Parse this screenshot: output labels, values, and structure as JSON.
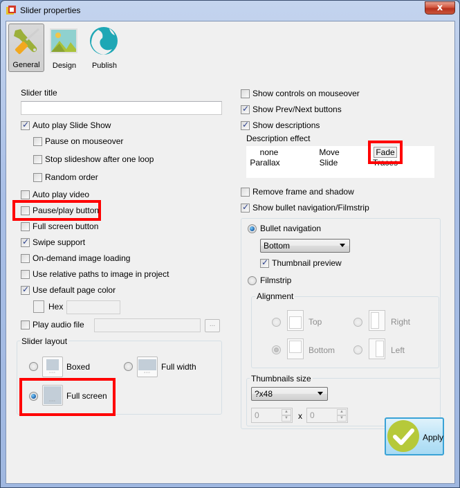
{
  "window": {
    "title": "Slider properties",
    "close_label": "x"
  },
  "tabs": [
    {
      "label": "General",
      "icon": "wrench-screwdriver-icon",
      "active": true
    },
    {
      "label": "Design",
      "icon": "picture-icon",
      "active": false
    },
    {
      "label": "Publish",
      "icon": "globe-icon",
      "active": false
    }
  ],
  "left": {
    "slider_title_label": "Slider title",
    "slider_title_value": "",
    "auto_play_slideshow": {
      "label": "Auto play Slide Show",
      "checked": true
    },
    "pause_on_mouseover": {
      "label": "Pause on mouseover",
      "checked": false
    },
    "stop_after_loop": {
      "label": "Stop slideshow after one loop",
      "checked": false
    },
    "random_order": {
      "label": "Random order",
      "checked": false
    },
    "auto_play_video": {
      "label": "Auto play video",
      "checked": false
    },
    "pause_play_button": {
      "label": "Pause/play button",
      "checked": false
    },
    "full_screen_button": {
      "label": "Full screen button",
      "checked": false
    },
    "swipe_support": {
      "label": "Swipe support",
      "checked": true
    },
    "on_demand_loading": {
      "label": "On-demand image loading",
      "checked": false
    },
    "relative_paths": {
      "label": "Use relative paths to image in project",
      "checked": false
    },
    "default_page_color": {
      "label": "Use default page color",
      "checked": true
    },
    "hex_label": "Hex",
    "hex_value": "",
    "play_audio": {
      "label": "Play audio file",
      "checked": false
    },
    "audio_file_value": "",
    "browse_label": "...",
    "slider_layout": {
      "title": "Slider layout",
      "options": [
        {
          "label": "Boxed",
          "selected": false
        },
        {
          "label": "Full width",
          "selected": false
        },
        {
          "label": "Full screen",
          "selected": true
        }
      ]
    }
  },
  "right": {
    "show_controls_mouseover": {
      "label": "Show controls on mouseover",
      "checked": false
    },
    "show_prev_next": {
      "label": "Show Prev/Next buttons",
      "checked": true
    },
    "show_descriptions": {
      "label": "Show descriptions",
      "checked": true
    },
    "description_effect_label": "Description effect",
    "effects": [
      {
        "label": "none",
        "selected": false
      },
      {
        "label": "Move",
        "selected": false
      },
      {
        "label": "Fade",
        "selected": true
      },
      {
        "label": "Parallax",
        "selected": false
      },
      {
        "label": "Slide",
        "selected": false
      },
      {
        "label": "Traces",
        "selected": false
      }
    ],
    "remove_frame": {
      "label": "Remove frame and shadow",
      "checked": false
    },
    "show_bullet_nav": {
      "label": "Show bullet navigation/Filmstrip",
      "checked": true
    },
    "bullet_navigation": {
      "label": "Bullet navigation",
      "selected": true
    },
    "bullet_position": "Bottom",
    "thumbnail_preview": {
      "label": "Thumbnail preview",
      "checked": true
    },
    "filmstrip": {
      "label": "Filmstrip",
      "selected": false
    },
    "alignment": {
      "title": "Alignment",
      "options": [
        {
          "label": "Top",
          "selected": false
        },
        {
          "label": "Right",
          "selected": false
        },
        {
          "label": "Bottom",
          "selected": true
        },
        {
          "label": "Left",
          "selected": false
        }
      ]
    },
    "thumbnails_size": {
      "title": "Thumbnails size",
      "selected": "?x48",
      "width": "0",
      "times": "x",
      "height": "0"
    }
  },
  "apply_label": "Apply",
  "colors": {
    "highlight": "#ff0000",
    "apply_accent": "#b6c93a",
    "apply_border": "#39a2d6"
  }
}
